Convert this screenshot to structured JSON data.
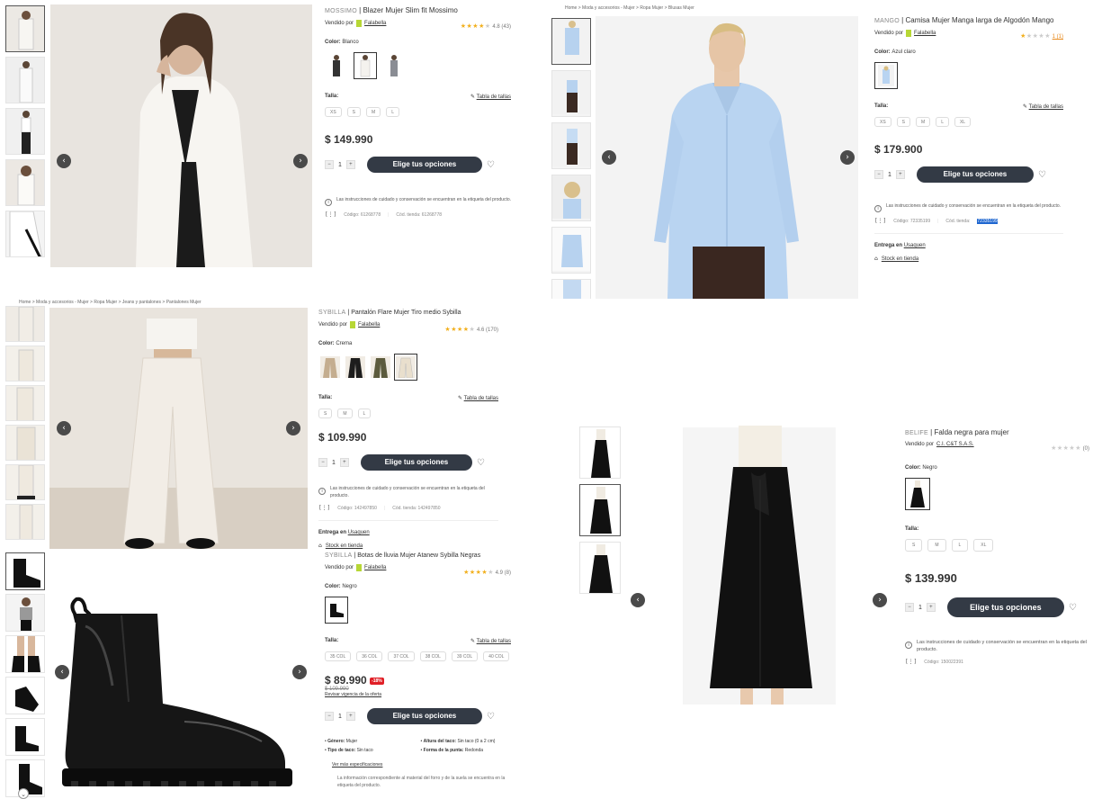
{
  "p1": {
    "brand": "MOSSIMO",
    "name": "Blazer Mujer Slim fit Mossimo",
    "seller_prefix": "Vendido por",
    "seller": "Falabella",
    "rating_text": "4.8 (43)",
    "color_label": "Color:",
    "color_value": "Blanco",
    "size_label": "Talla:",
    "size_table": "Tabla de tallas",
    "sizes": [
      "XS",
      "S",
      "M",
      "L"
    ],
    "price": "$ 149.990",
    "qty": "1",
    "cta": "Elige tus opciones",
    "care_note": "Las instrucciones de cuidado y conservación se encuentran en la etiqueta del producto.",
    "code": "Código: 61268778",
    "store_code": "Cód. tienda: 61268778"
  },
  "p2": {
    "breadcrumb": "Home > Moda y accesorios - Mujer > Ropa Mujer > Blusas Mujer",
    "brand": "MANGO",
    "name": "Camisa Mujer Manga larga de Algodón Mango",
    "seller_prefix": "Vendido por",
    "seller": "Falabella",
    "rating_text": "1 (1)",
    "color_label": "Color:",
    "color_value": "Azul claro",
    "size_label": "Talla:",
    "size_table": "Tabla de tallas",
    "sizes": [
      "XS",
      "S",
      "M",
      "L",
      "XL"
    ],
    "price": "$ 179.900",
    "qty": "1",
    "cta": "Elige tus opciones",
    "care_note": "Las instrucciones de cuidado y conservación se encuentran en la etiqueta del producto.",
    "code": "Código: 72335199",
    "store_code_prefix": "Cód. tienda:",
    "store_code_value": "72335199",
    "delivery": "Entrega en",
    "delivery_link": "Usaquen",
    "stock": "Stock en tienda"
  },
  "p3": {
    "breadcrumb": "Home > Moda y accesorios - Mujer > Ropa Mujer > Jeans y pantalones > Pantalones Mujer",
    "brand": "SYBILLA",
    "name": "Pantalón Flare Mujer Tiro medio Sybilla",
    "seller_prefix": "Vendido por",
    "seller": "Falabella",
    "rating_text": "4.6 (170)",
    "color_label": "Color:",
    "color_value": "Crema",
    "size_label": "Talla:",
    "size_table": "Tabla de tallas",
    "sizes": [
      "S",
      "M",
      "L"
    ],
    "price": "$ 109.990",
    "qty": "1",
    "cta": "Elige tus opciones",
    "care_note": "Las instrucciones de cuidado y conservación se encuentran en la etiqueta del producto.",
    "code": "Código: 142497850",
    "store_code": "Cód. tienda: 142497850",
    "delivery": "Entrega en",
    "delivery_link": "Usaquen",
    "stock": "Stock en tienda"
  },
  "p4": {
    "brand": "SYBILLA",
    "name": "Botas de lluvia Mujer Atanew Sybilla Negras",
    "seller_prefix": "Vendido por",
    "seller": "Falabella",
    "rating_text": "4.9 (8)",
    "color_label": "Color:",
    "color_value": "Negro",
    "size_label": "Talla:",
    "size_table": "Tabla de tallas",
    "sizes": [
      "35 COL",
      "36 COL",
      "37 COL",
      "38 COL",
      "39 COL",
      "40 COL"
    ],
    "price": "$ 89.990",
    "discount": "-18%",
    "old_price": "$ 109.990",
    "promo_link": "Revisar vigencia de la oferta",
    "qty": "1",
    "cta": "Elige tus opciones",
    "specs": [
      {
        "k": "Género:",
        "v": "Mujer"
      },
      {
        "k": "Altura del taco:",
        "v": "Sin taco (0 a 2 cm)"
      },
      {
        "k": "Tipo de taco:",
        "v": "Sin taco"
      },
      {
        "k": "Forma de la punta:",
        "v": "Redonda"
      }
    ],
    "more_specs": "Ver más especificaciones",
    "material_note": "La información correspondiente al material del forro y de la suela se encuentra en la etiqueta del producto."
  },
  "p5": {
    "brand": "BELIFE",
    "name": "Falda negra para mujer",
    "seller_prefix": "Vendido por",
    "seller": "C.I. C&T S.A.S.",
    "rating_text": "(0)",
    "color_label": "Color:",
    "color_value": "Negro",
    "size_label": "Talla:",
    "sizes": [
      "S",
      "M",
      "L",
      "XL"
    ],
    "price": "$ 139.990",
    "qty": "1",
    "cta": "Elige tus opciones",
    "care_note": "Las instrucciones de cuidado y conservación se encuentran en la etiqueta del producto.",
    "code": "Código: 150022391"
  }
}
